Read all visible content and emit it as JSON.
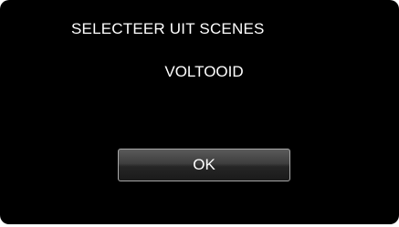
{
  "dialog": {
    "title": "SELECTEER UIT SCENES",
    "message": "VOLTOOID",
    "ok_label": "OK"
  },
  "colors": {
    "screen_background": "#000000",
    "text": "#ffffff",
    "button_border": "#a8a8a8"
  }
}
